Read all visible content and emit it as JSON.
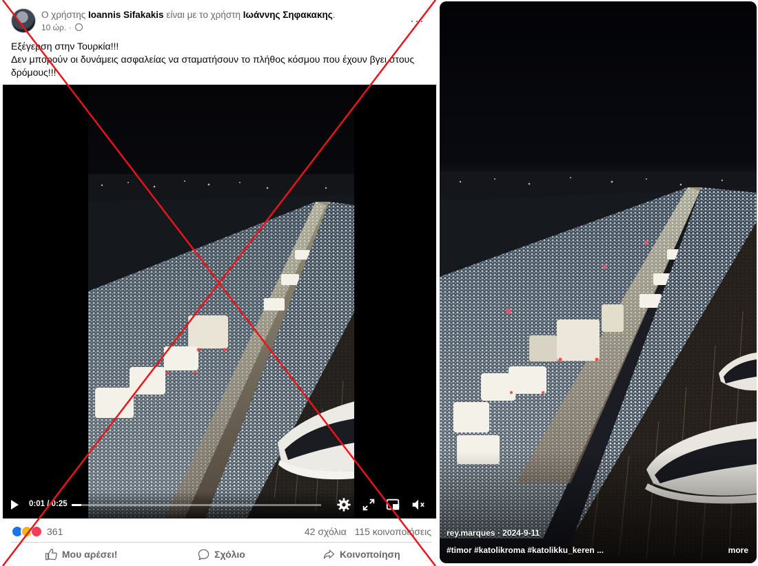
{
  "post": {
    "header_prefix": "Ο χρήστης",
    "author": "Ioannis Sifakakis",
    "header_mid": "είναι με το χρήστη",
    "tagged": "Ιωάννης Σηφακακης",
    "header_end": ".",
    "time": "10 ώρ. ·",
    "more_label": "···",
    "text_line1": "Εξέγερση στην Τουρκία!!!",
    "text_line2": "Δεν μπορούν οι δυνάμεις ασφαλείας να σταματήσουν το πλήθος κόσμου που έχουν βγει στους δρόμους!!!"
  },
  "video": {
    "current_time": "0:01",
    "separator": " / ",
    "duration": "0:25",
    "progress": 0.04
  },
  "stats": {
    "reactions_count": "361",
    "comments": "42 σχόλια",
    "shares": "115 κοινοποιήσεις"
  },
  "actions": {
    "like": "Μου αρέσει!",
    "comment": "Σχόλιο",
    "share": "Κοινοποίηση"
  },
  "reel": {
    "author_date": "rey.marques · 2024-9-11",
    "tags": "#timor  #katolikroma  #katolikku_keren ...",
    "more": "more"
  },
  "colors": {
    "fb_blue": "#1877f2",
    "like_blue": "#1b74e4",
    "love_red": "#f33e58",
    "care_yellow": "#f7b125",
    "cross_red": "#e8151b",
    "muted_text": "#65676b"
  },
  "icons": [
    "avatar",
    "globe-icon",
    "more-icon",
    "play-icon",
    "settings-icon",
    "fullscreen-icon",
    "pip-icon",
    "mute-icon",
    "like-icon",
    "comment-icon",
    "share-icon"
  ]
}
